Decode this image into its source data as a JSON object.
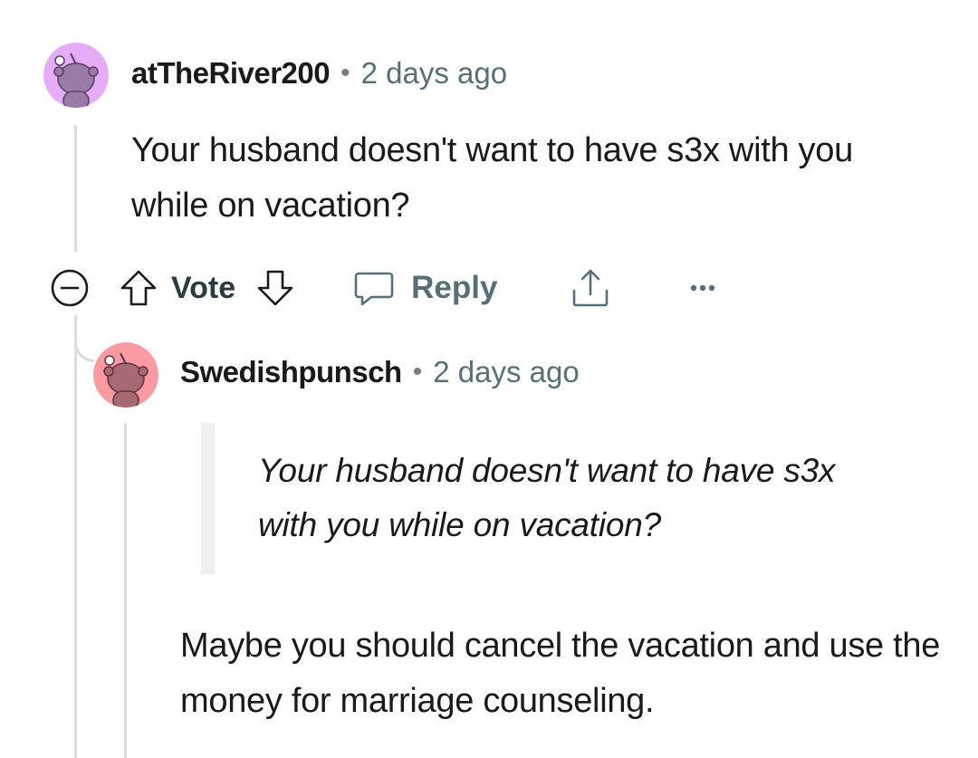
{
  "parent_comment": {
    "username": "atTheRiver200",
    "separator": "•",
    "timestamp": "2 days ago",
    "body": "Your husband doesn't want to have s3x with you while on vacation?",
    "avatar_color": "#e5adf7",
    "avatar_figure_color": "#9a7aa6"
  },
  "actions": {
    "collapse_icon": "collapse-minus-icon",
    "upvote_icon": "upvote-arrow-icon",
    "vote_label": "Vote",
    "downvote_icon": "downvote-arrow-icon",
    "reply_icon": "comment-bubble-icon",
    "reply_label": "Reply",
    "share_icon": "share-icon",
    "more_icon": "more-options-icon"
  },
  "child_comment": {
    "username": "Swedishpunsch",
    "separator": "•",
    "timestamp": "2 days ago",
    "quote": "Your husband doesn't want to have s3x with you while on vacation?",
    "body": "Maybe you should cancel the vacation and use the money for marriage counseling.",
    "avatar_color": "#fa9aa3",
    "avatar_figure_color": "#a86a72"
  }
}
